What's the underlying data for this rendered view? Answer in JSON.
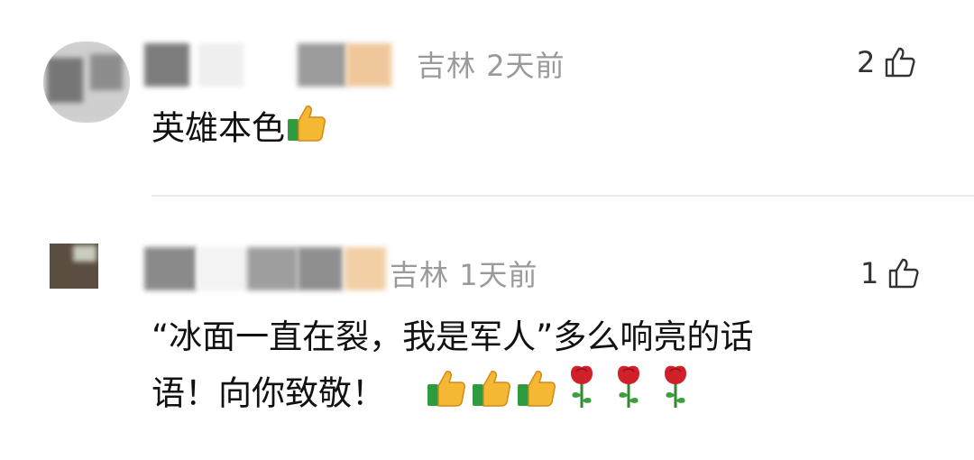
{
  "comments": [
    {
      "location": "吉林",
      "time": "2天前",
      "likes": "2",
      "text": "英雄本色",
      "emojis": [
        "thumbs-up"
      ]
    },
    {
      "location": "吉林",
      "time": "1天前",
      "likes": "1",
      "text_line1": "“冰面一直在裂，我是军人”多么响亮的话",
      "text_line2": "语！向你致敬！",
      "emojis": [
        "thumbs-up",
        "thumbs-up",
        "thumbs-up",
        "rose",
        "rose",
        "rose"
      ]
    }
  ]
}
